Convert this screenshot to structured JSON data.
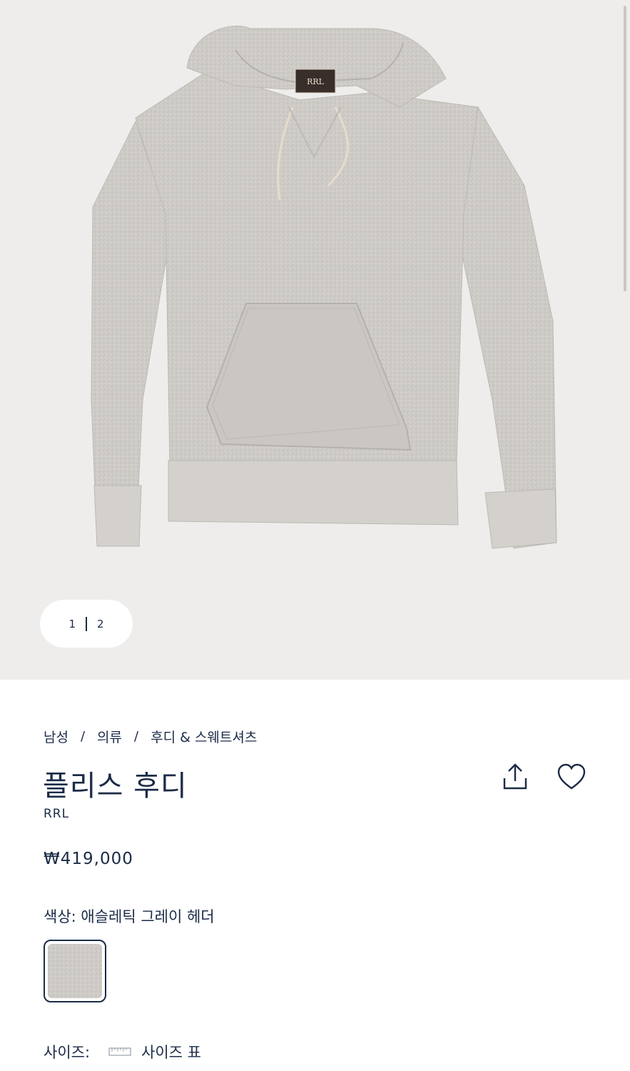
{
  "gallery": {
    "product_image_label": "RRL",
    "pager": {
      "current": "1",
      "total": "2"
    }
  },
  "breadcrumb": [
    "남성",
    "의류",
    "후디 & 스웨트셔츠"
  ],
  "product": {
    "title": "플리스 후디",
    "brand": "RRL",
    "price": "₩419,000"
  },
  "color": {
    "label": "색상: 애슬레틱 그레이 헤더",
    "swatch_color": "#d6d3cf"
  },
  "size": {
    "label": "사이즈:",
    "chart_link": "사이즈 표"
  },
  "icons": {
    "share": "share-icon",
    "wishlist": "heart-icon",
    "size_chart": "ruler-icon"
  },
  "colors": {
    "text": "#1b2b47",
    "gallery_bg": "#efedeb",
    "hoodie": "#cfccc8"
  }
}
